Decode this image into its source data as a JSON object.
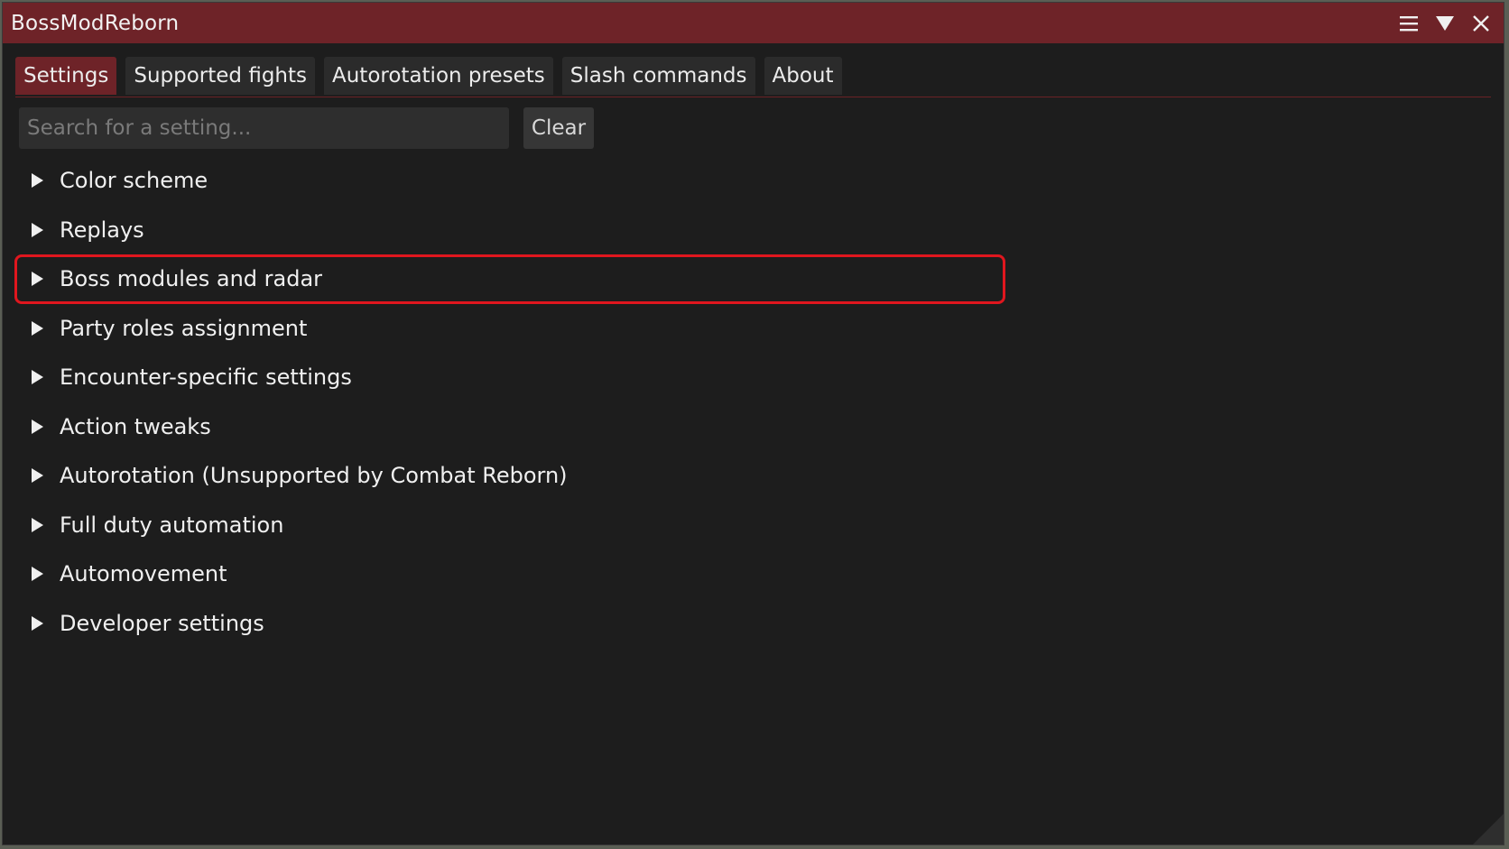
{
  "window": {
    "title": "BossModReborn",
    "icons": [
      "menu-icon",
      "collapse-icon",
      "close-icon"
    ]
  },
  "tabs": [
    {
      "label": "Settings",
      "active": true
    },
    {
      "label": "Supported fights",
      "active": false
    },
    {
      "label": "Autorotation presets",
      "active": false
    },
    {
      "label": "Slash commands",
      "active": false
    },
    {
      "label": "About",
      "active": false
    }
  ],
  "search": {
    "placeholder": "Search for a setting...",
    "value": "",
    "clear_label": "Clear"
  },
  "settings": [
    {
      "label": "Color scheme",
      "highlighted": false
    },
    {
      "label": "Replays",
      "highlighted": false
    },
    {
      "label": "Boss modules and radar",
      "highlighted": true
    },
    {
      "label": "Party roles assignment",
      "highlighted": false
    },
    {
      "label": "Encounter-specific settings",
      "highlighted": false
    },
    {
      "label": "Action tweaks",
      "highlighted": false
    },
    {
      "label": "Autorotation (Unsupported by Combat Reborn)",
      "highlighted": false
    },
    {
      "label": "Full duty automation",
      "highlighted": false
    },
    {
      "label": "Automovement",
      "highlighted": false
    },
    {
      "label": "Developer settings",
      "highlighted": false
    }
  ],
  "colors": {
    "title_bar": "#6e2328",
    "active_tab": "#6e2328",
    "window_bg": "#1d1d1d",
    "highlight_outline": "#e0161e"
  }
}
